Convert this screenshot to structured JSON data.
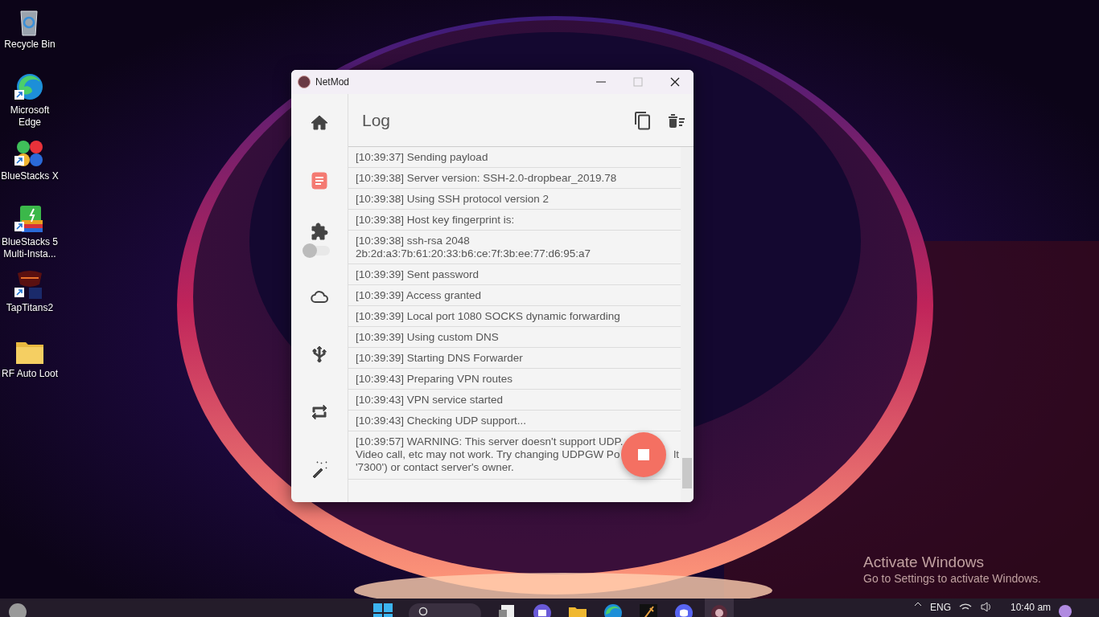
{
  "desktop_icons": [
    {
      "label": "Recycle Bin",
      "kind": "recycle"
    },
    {
      "label": "Microsoft Edge",
      "kind": "edge"
    },
    {
      "label": "BlueStacks X",
      "kind": "bluestacksx"
    },
    {
      "label": "BlueStacks 5 Multi-Insta...",
      "kind": "bluestacks5"
    },
    {
      "label": "TapTitans2",
      "kind": "game"
    },
    {
      "label": "RF Auto Loot",
      "kind": "folder"
    }
  ],
  "window": {
    "title": "NetMod",
    "page_title": "Log",
    "nav_items": [
      {
        "kind": "home",
        "selected": false
      },
      {
        "kind": "log",
        "selected": true
      },
      {
        "kind": "plugin",
        "selected": false,
        "toggle_on": false
      },
      {
        "kind": "cloud",
        "selected": false
      },
      {
        "kind": "usb",
        "selected": false
      },
      {
        "kind": "repeat",
        "selected": false
      },
      {
        "kind": "wand",
        "selected": false
      }
    ],
    "log": [
      {
        "text": "[10:39:37] Sending payload"
      },
      {
        "text": "[10:39:38] Server version: SSH-2.0-dropbear_2019.78"
      },
      {
        "text": "[10:39:38] Using SSH protocol version 2"
      },
      {
        "text": "[10:39:38] Host key fingerprint is:"
      },
      {
        "text": "[10:39:38] ssh-rsa 2048 2b:2d:a3:7b:61:20:33:b6:ce:7f:3b:ee:77:d6:95:a7"
      },
      {
        "text": "[10:39:39] Sent password"
      },
      {
        "text": "[10:39:39] Access granted"
      },
      {
        "text": "[10:39:39] Local port 1080 SOCKS dynamic forwarding"
      },
      {
        "text": "[10:39:39] Using custom DNS"
      },
      {
        "text": "[10:39:39] Starting DNS Forwarder"
      },
      {
        "text": "[10:39:43] Preparing VPN routes"
      },
      {
        "text": "[10:39:43] VPN service started"
      },
      {
        "text": "[10:39:43] Checking UDP support..."
      },
      {
        "lines": [
          [
            "[10:39:57] WARNING: This server doesn't support UDP."
          ],
          [
            "Video call, etc may not work. Try changing UDPGW Po",
            "lt"
          ],
          [
            "'7300') or contact server's owner."
          ]
        ]
      }
    ]
  },
  "activation_notice": {
    "title": "Activate Windows",
    "text": "Go to Settings to activate Windows."
  },
  "taskbar": {
    "apps": [
      {
        "kind": "start",
        "selected": false
      },
      {
        "kind": "search"
      },
      {
        "kind": "file",
        "selected": false
      },
      {
        "kind": "chat",
        "selected": false
      },
      {
        "kind": "folder",
        "selected": false
      },
      {
        "kind": "edge",
        "selected": false
      },
      {
        "kind": "game",
        "selected": false
      },
      {
        "kind": "discord",
        "selected": false
      },
      {
        "kind": "netmod",
        "selected": true
      }
    ],
    "language": "ENG",
    "time": "10:40 am"
  }
}
